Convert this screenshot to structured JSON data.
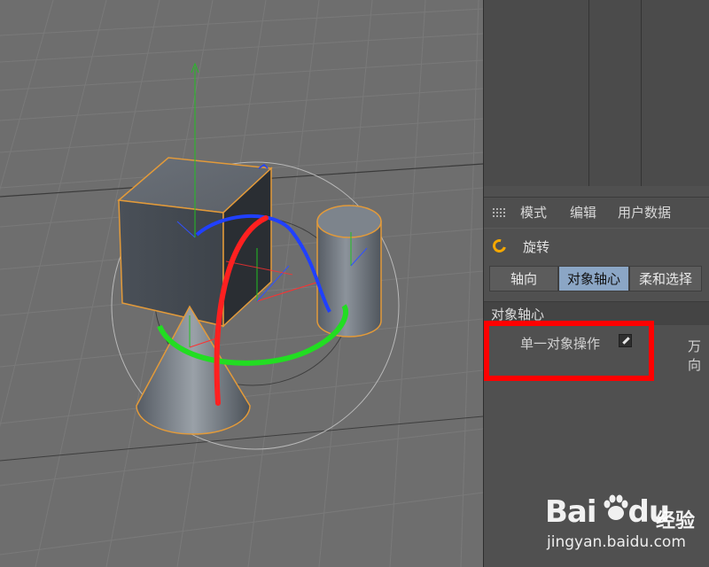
{
  "menu": {
    "items": [
      "模式",
      "编辑",
      "用户数据"
    ]
  },
  "tool": {
    "name": "旋转",
    "icon": "rotate-icon"
  },
  "tabs": [
    {
      "label": "轴向",
      "active": false
    },
    {
      "label": "对象轴心",
      "active": true
    },
    {
      "label": "柔和选择",
      "active": false
    }
  ],
  "section": {
    "title": "对象轴心"
  },
  "options": {
    "single_object_label": "单一对象操作",
    "single_object_checked": true,
    "gimbal_label": "万向"
  },
  "watermark": {
    "brand": "Bai",
    "brand_suffix": "du",
    "cn": "经验",
    "url": "jingyan.baidu.com"
  },
  "colors": {
    "highlight": "#ff0000",
    "active_tab": "#8ba6c5",
    "tool_icon": "#f5a800",
    "selection_outline": "#e29a3a",
    "axis_x": "#ff2020",
    "axis_y": "#20d020",
    "axis_z": "#2040ff"
  }
}
